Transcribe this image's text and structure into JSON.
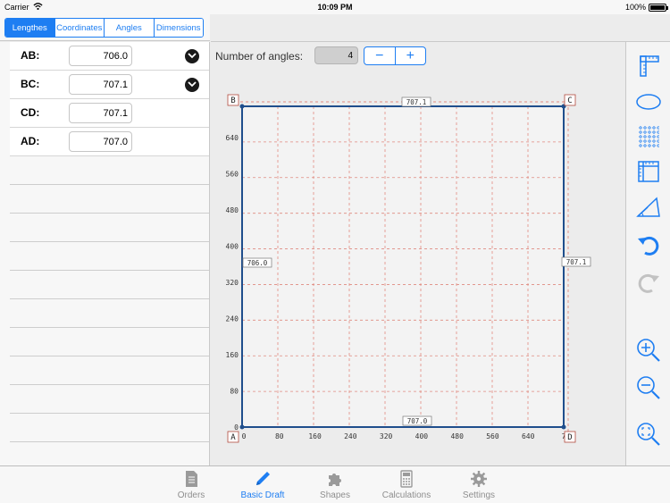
{
  "status": {
    "carrier": "Carrier",
    "time": "10:09 PM",
    "battery": "100%"
  },
  "segments": [
    "Lengthes",
    "Coordinates",
    "Angles",
    "Dimensions"
  ],
  "lengths": [
    {
      "label": "AB:",
      "value": "706.0"
    },
    {
      "label": "BC:",
      "value": "707.1"
    },
    {
      "label": "CD:",
      "value": "707.1"
    },
    {
      "label": "AD:",
      "value": "707.0"
    }
  ],
  "angles": {
    "label": "Number of angles:",
    "value": "4",
    "minus": "−",
    "plus": "+"
  },
  "drawing": {
    "y_ticks": [
      "640",
      "560",
      "480",
      "400",
      "320",
      "240",
      "160",
      "80",
      "0"
    ],
    "x_ticks": [
      "0",
      "80",
      "160",
      "240",
      "320",
      "400",
      "480",
      "560",
      "640",
      "7"
    ],
    "vertices": [
      "A",
      "B",
      "C",
      "D"
    ],
    "edge_labels": {
      "top": "707.1",
      "left": "706.0",
      "right": "707.1",
      "bottom": "707.0"
    },
    "color": "#1f4e8c",
    "grid_color": "#e08a80"
  },
  "tools": [
    "ruler-icon",
    "ellipse-icon",
    "grid-icon",
    "measure-icon",
    "triangle-icon",
    "undo-icon",
    "redo-icon",
    "zoom-in-icon",
    "zoom-out-icon",
    "zoom-fit-icon"
  ],
  "tabs": [
    {
      "label": "Orders",
      "icon": "document-icon"
    },
    {
      "label": "Basic Draft",
      "icon": "pencil-icon",
      "active": true
    },
    {
      "label": "Shapes",
      "icon": "puzzle-icon"
    },
    {
      "label": "Calculations",
      "icon": "calculator-icon"
    },
    {
      "label": "Settings",
      "icon": "gear-icon"
    }
  ],
  "accent": "#1e7ef2"
}
